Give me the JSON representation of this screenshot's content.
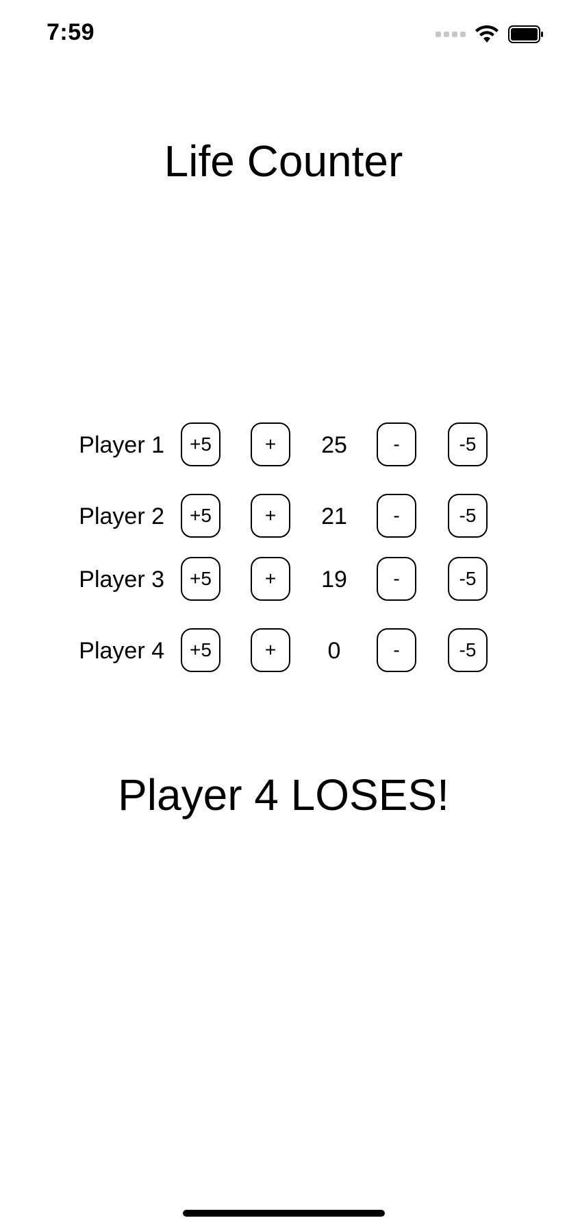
{
  "status_bar": {
    "time": "7:59",
    "icons": [
      "signal-icon",
      "wifi-icon",
      "battery-icon"
    ]
  },
  "title": "Life Counter",
  "buttons": {
    "plus5": "+5",
    "plus": "+",
    "minus": "-",
    "minus5": "-5"
  },
  "players": [
    {
      "name": "Player 1",
      "life": "25"
    },
    {
      "name": "Player 2",
      "life": "21"
    },
    {
      "name": "Player 3",
      "life": "19"
    },
    {
      "name": "Player 4",
      "life": "0"
    }
  ],
  "result_message": "Player 4 LOSES!"
}
